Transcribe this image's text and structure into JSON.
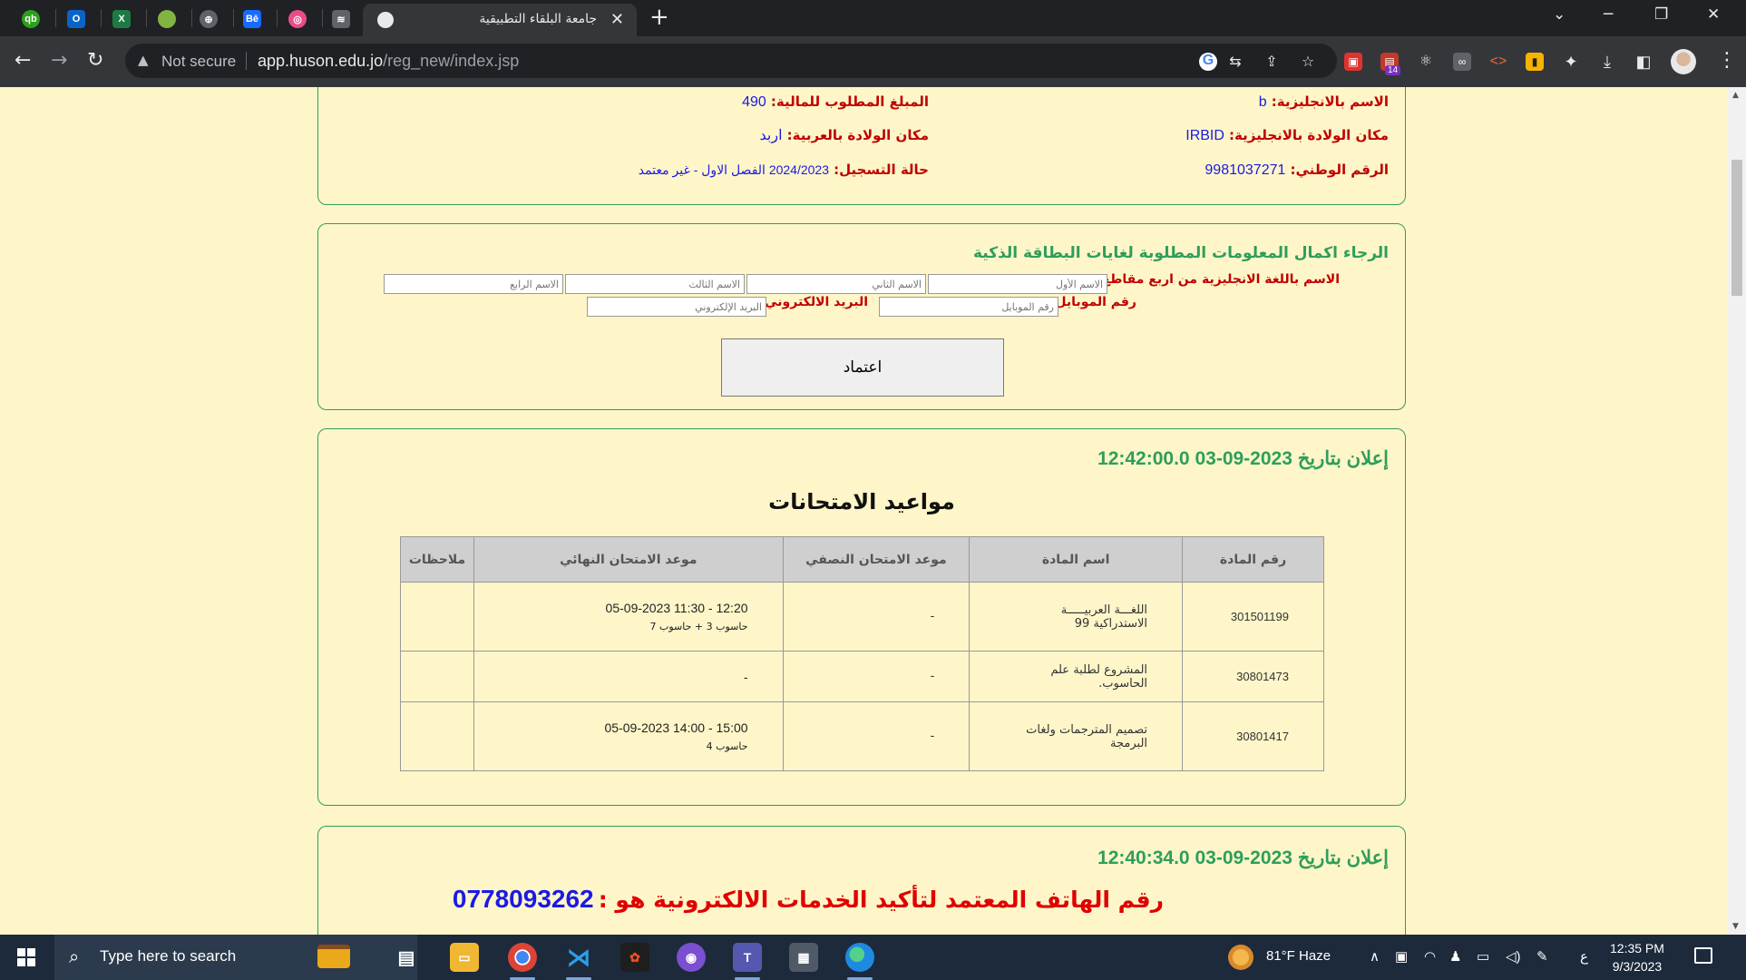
{
  "browser": {
    "active_tab_title": "جامعة البلقاء التطبيقية",
    "new_tab": "+",
    "close_tab": "✕",
    "url_warning": "Not secure",
    "url_host": "app.huson.edu.jo",
    "url_path": "/reg_new/index.jsp",
    "extension_badge": "14",
    "pinned_tabs": [
      "qb",
      "Outlook",
      "Excel",
      "Envato",
      "Web",
      "Behance",
      "Dribbble",
      "Layers"
    ]
  },
  "student_info": {
    "name_en_label": "الاسم بالانجليزية:",
    "name_en_value": "b",
    "amount_label": "المبلغ المطلوب للمالية:",
    "amount_value": "490",
    "birthplace_en_label": "مكان الولادة بالانجليزية:",
    "birthplace_en_value": "IRBID",
    "birthplace_ar_label": "مكان الولادة بالعربية:",
    "birthplace_ar_value": "اربد",
    "national_id_label": "الرقم الوطني:",
    "national_id_value": "9981037271",
    "reg_status_label": "حالة التسجيل:",
    "reg_status_value": "2024/2023 الفصل الاول - غير معتمد"
  },
  "smart_card": {
    "heading": "الرجاء اكمال المعلومات المطلوبة لغايات البطاقة الذكية",
    "name_label": "الاسم باللغة الانجليزية من اربع مقاطع:",
    "first_placeholder": "الاسم الأول",
    "second_placeholder": "الاسم الثاني",
    "third_placeholder": "الاسم الثالث",
    "fourth_placeholder": "الاسم الرابع",
    "mobile_label": "رقم الموبايل:",
    "mobile_placeholder": "رقم الموبايل",
    "email_label": "البريد الالكتروني:",
    "email_placeholder": "البريد الإلكتروني",
    "submit_label": "اعتماد"
  },
  "announcement1": {
    "date": "إعلان بتاريخ 2023-09-03 12:42:00.0",
    "title": "مواعيد الامتحانات",
    "headers": [
      "رقم المادة",
      "اسم المادة",
      "موعد الامتحان النصفي",
      "موعد الامتحان النهائي",
      "ملاحظات"
    ],
    "rows": [
      {
        "code": "301501199",
        "name": "اللغـــة العربيـــــة الاستدراكية 99",
        "midterm": "-",
        "final_time": "05-09-2023 11:30 - 12:20",
        "final_place": "حاسوب 3 + حاسوب 7",
        "notes": ""
      },
      {
        "code": "30801473",
        "name": "المشروع لطلبة علم الحاسوب.",
        "midterm": "-",
        "final_time": "-",
        "final_place": "",
        "notes": ""
      },
      {
        "code": "30801417",
        "name": "تصميم المترجمات ولغات البرمجة",
        "midterm": "-",
        "final_time": "05-09-2023 14:00 - 15:00",
        "final_place": "حاسوب 4",
        "notes": ""
      }
    ]
  },
  "announcement2": {
    "date": "إعلان بتاريخ 2023-09-03 12:40:34.0",
    "phone_text": "رقم الهاتف المعتمد لتأكيد الخدمات الالكترونية هو :",
    "phone_number": "0778093262"
  },
  "taskbar": {
    "search_placeholder": "Type here to search",
    "weather": "81°F  Haze",
    "lang": "ع",
    "time": "12:35 PM",
    "date": "9/3/2023"
  }
}
